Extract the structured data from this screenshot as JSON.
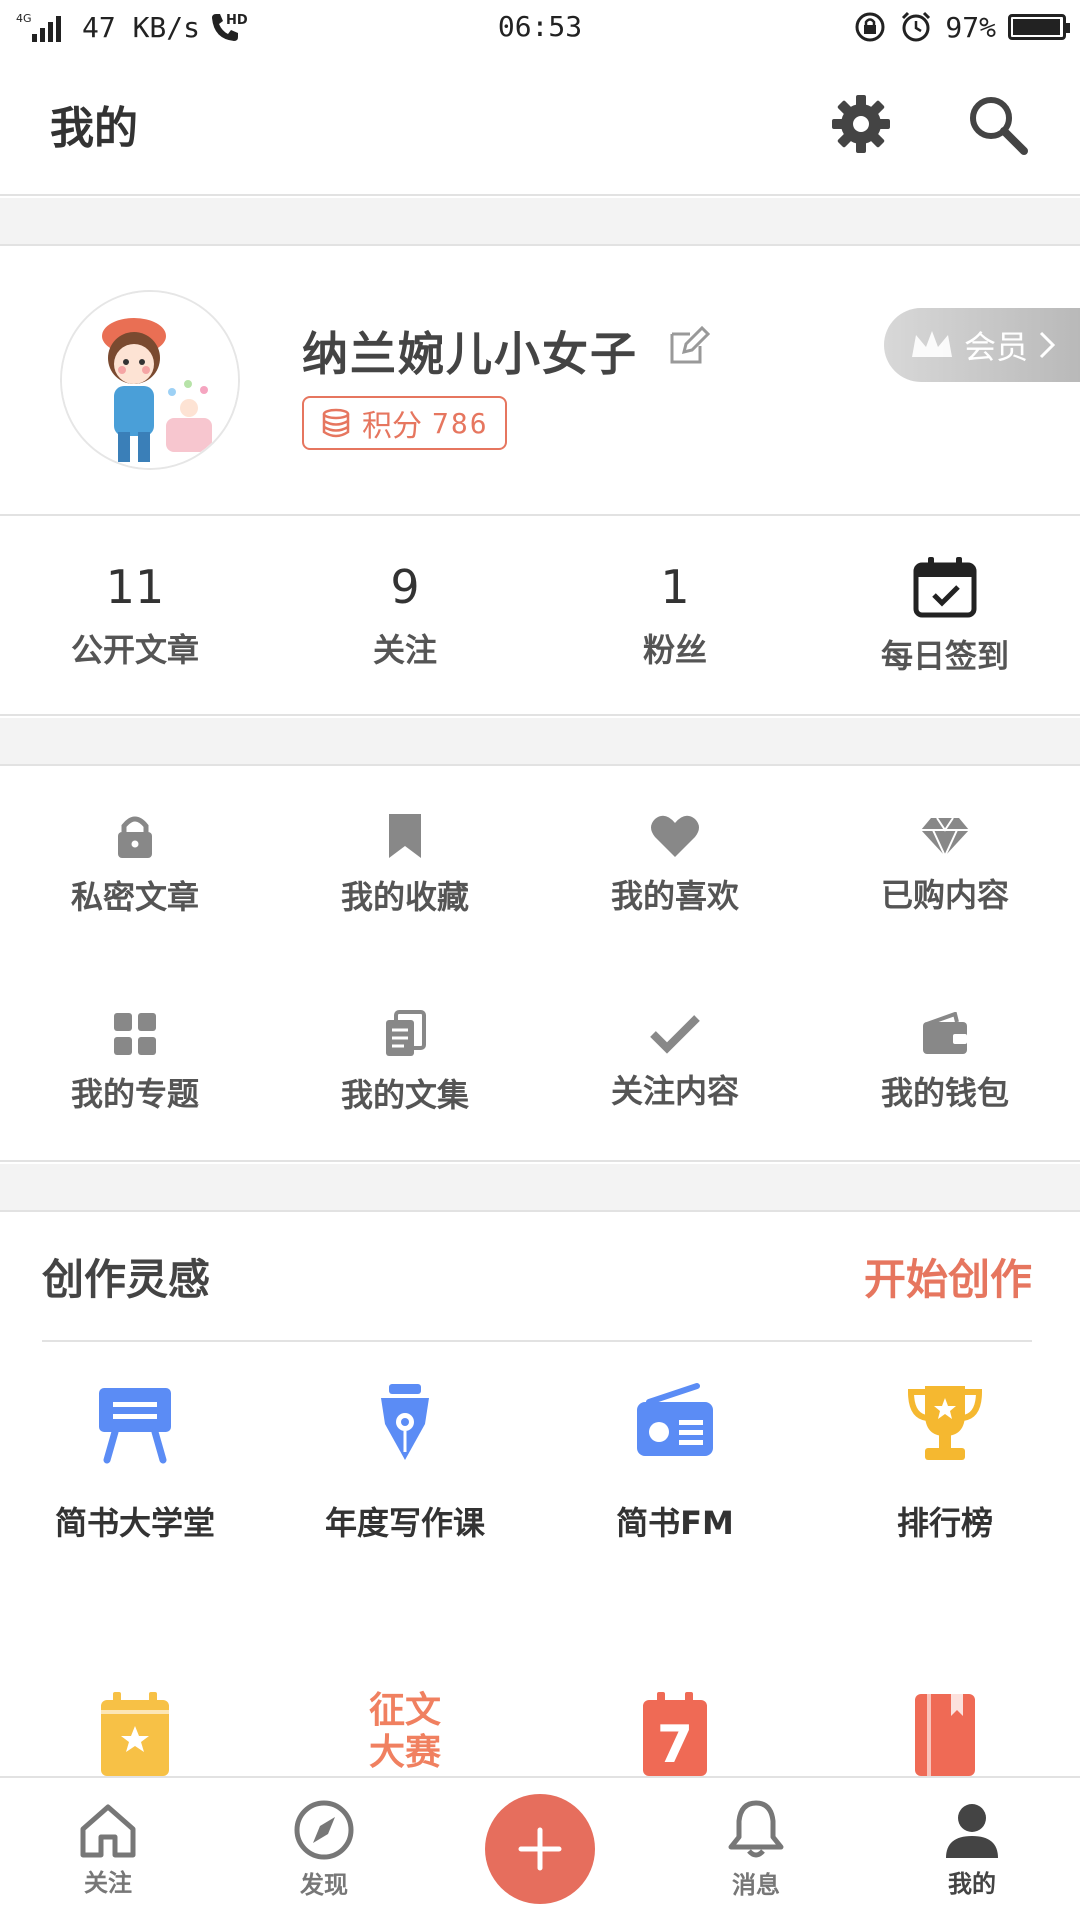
{
  "status_bar": {
    "network": "4G",
    "speed": "47 KB/s",
    "hd": "HD",
    "time": "06:53",
    "battery": "97%",
    "battery_level": 0.97
  },
  "header": {
    "title": "我的"
  },
  "profile": {
    "username": "纳兰婉儿小女子",
    "score_label": "积分",
    "score_value": "786",
    "member_label": "会员"
  },
  "stats": [
    {
      "value": "11",
      "label": "公开文章"
    },
    {
      "value": "9",
      "label": "关注"
    },
    {
      "value": "1",
      "label": "粉丝"
    },
    {
      "value": "",
      "label": "每日签到"
    }
  ],
  "grid": [
    {
      "label": "私密文章",
      "icon": "lock-icon"
    },
    {
      "label": "我的收藏",
      "icon": "bookmark-icon"
    },
    {
      "label": "我的喜欢",
      "icon": "heart-icon"
    },
    {
      "label": "已购内容",
      "icon": "diamond-icon"
    },
    {
      "label": "我的专题",
      "icon": "grid-icon"
    },
    {
      "label": "我的文集",
      "icon": "documents-icon"
    },
    {
      "label": "关注内容",
      "icon": "check-icon"
    },
    {
      "label": "我的钱包",
      "icon": "wallet-icon"
    }
  ],
  "inspiration": {
    "title": "创作灵感",
    "start": "开始创作"
  },
  "tools": [
    {
      "label": "简书大学堂",
      "icon": "easel-icon"
    },
    {
      "label": "年度写作课",
      "icon": "pen-nib-icon"
    },
    {
      "label": "简书FM",
      "icon": "radio-icon"
    },
    {
      "label": "排行榜",
      "icon": "trophy-icon"
    }
  ],
  "tools2": {
    "contest_line1": "征文",
    "contest_line2": "大赛",
    "calendar_day": "7"
  },
  "bottom_nav": [
    {
      "label": "关注",
      "icon": "home-icon"
    },
    {
      "label": "发现",
      "icon": "compass-icon"
    },
    {
      "label": "",
      "icon": "plus-icon"
    },
    {
      "label": "消息",
      "icon": "bell-icon"
    },
    {
      "label": "我的",
      "icon": "person-icon"
    }
  ],
  "colors": {
    "accent": "#e6765f",
    "blue": "#5b8cf5",
    "gold": "#f5b830",
    "text": "#333333"
  }
}
